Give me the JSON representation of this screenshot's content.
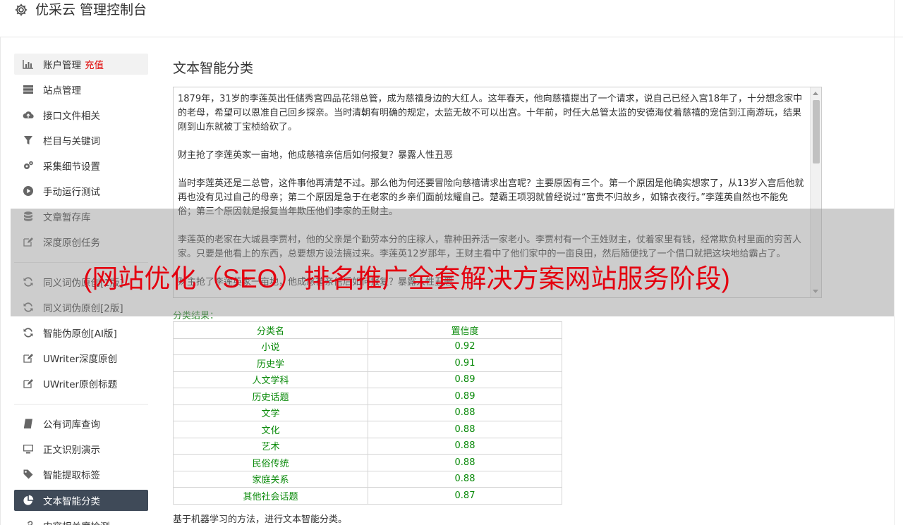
{
  "app": {
    "title": "优采云 管理控制台",
    "brand_icon": "gear-icon"
  },
  "sidebar": {
    "items": [
      {
        "label": "账户管理",
        "badge": "充值",
        "icon": "bar-chart-icon",
        "state": "hover"
      },
      {
        "label": "站点管理",
        "icon": "server-icon"
      },
      {
        "label": "接口文件相关",
        "icon": "cloud-upload-icon"
      },
      {
        "label": "栏目与关键词",
        "icon": "filter-icon"
      },
      {
        "label": "采集细节设置",
        "icon": "cogs-icon"
      },
      {
        "label": "手动运行测试",
        "icon": "play-circle-icon"
      },
      {
        "label": "文章暂存库",
        "icon": "database-icon"
      },
      {
        "label": "深度原创任务",
        "icon": "edit-icon"
      },
      {
        "label": "同义词伪原创[1版]",
        "icon": "refresh-icon"
      },
      {
        "label": "同义词伪原创[2版]",
        "icon": "refresh-icon"
      },
      {
        "label": "智能伪原创[AI版]",
        "icon": "refresh-icon"
      },
      {
        "label": "UWriter深度原创",
        "icon": "edit-icon"
      },
      {
        "label": "UWriter原创标题",
        "icon": "edit-icon"
      },
      {
        "label": "公有词库查询",
        "icon": "book-icon"
      },
      {
        "label": "正文识别演示",
        "icon": "desktop-icon"
      },
      {
        "label": "智能提取标签",
        "icon": "tag-icon"
      },
      {
        "label": "文本智能分类",
        "icon": "pie-chart-icon",
        "state": "active"
      },
      {
        "label": "内容相关度检测",
        "icon": "link-icon"
      }
    ]
  },
  "main": {
    "title": "文本智能分类",
    "textarea_paragraphs": [
      "1879年，31岁的李莲英出任储秀宫四品花翎总管，成为慈禧身边的大红人。这年春天，他向慈禧提出了一个请求，说自己已经入宫18年了，十分想念家中的老母，希望可以恩准自己回乡探亲。当时清朝有明确的规定，太监无故不可以出宫。十年前，时任大总管太监的安德海仗着慈禧的宠信到江南游玩，结果刚到山东就被丁宝桢给砍了。",
      "财主抢了李莲英家一亩地，他成慈禧亲信后如何报复？暴露人性丑恶",
      "当时李莲英还是二总管，这件事他再清楚不过。那么他为何还要冒险向慈禧请求出宫呢？主要原因有三个。第一个原因是他确实想家了，从13岁入宫后他就再也没有见过自己的母亲；第二个原因是急于在老家的乡亲们面前炫耀自己。楚霸王项羽就曾经说过“富贵不归故乡，如锦衣夜行。”李莲英自然也不能免俗；第三个原因就是报复当年欺压他们李家的王财主。",
      "李莲英的老家在大城县李贾村，他的父亲是个勤劳本分的庄稼人，靠种田养活一家老小。李贾村有一个王姓财主，仗着家里有钱，经常欺负村里面的穷苦人家。只要是他看上的东西，总要想方设法搞过来。李莲英12岁那年，王财主看中了他们家中的一亩良田，然后随便找了一个借口就把这块地给霸占了。",
      "财主抢了李莲英家一亩地，他成慈禧亲信后如何报复？暴露人性丑恶"
    ],
    "result_label": "分类结果：",
    "table": {
      "headers": [
        "分类名",
        "置信度"
      ],
      "rows": [
        [
          "小说",
          "0.92"
        ],
        [
          "历史学",
          "0.91"
        ],
        [
          "人文学科",
          "0.89"
        ],
        [
          "历史话题",
          "0.89"
        ],
        [
          "文学",
          "0.88"
        ],
        [
          "文化",
          "0.88"
        ],
        [
          "艺术",
          "0.88"
        ],
        [
          "民俗传统",
          "0.88"
        ],
        [
          "家庭关系",
          "0.88"
        ],
        [
          "其他社会话题",
          "0.87"
        ]
      ]
    },
    "footer_note": "基于机器学习的方法，进行文本智能分类。"
  },
  "overlay": {
    "text": "(网站优化（SEO）排名推广全套解决方案网站服务阶段)"
  },
  "colors": {
    "active_bg": "#3f4a58",
    "result_green": "#0a8a0a",
    "recharge_red": "#e00000",
    "overlay_red": "#e4000f"
  }
}
